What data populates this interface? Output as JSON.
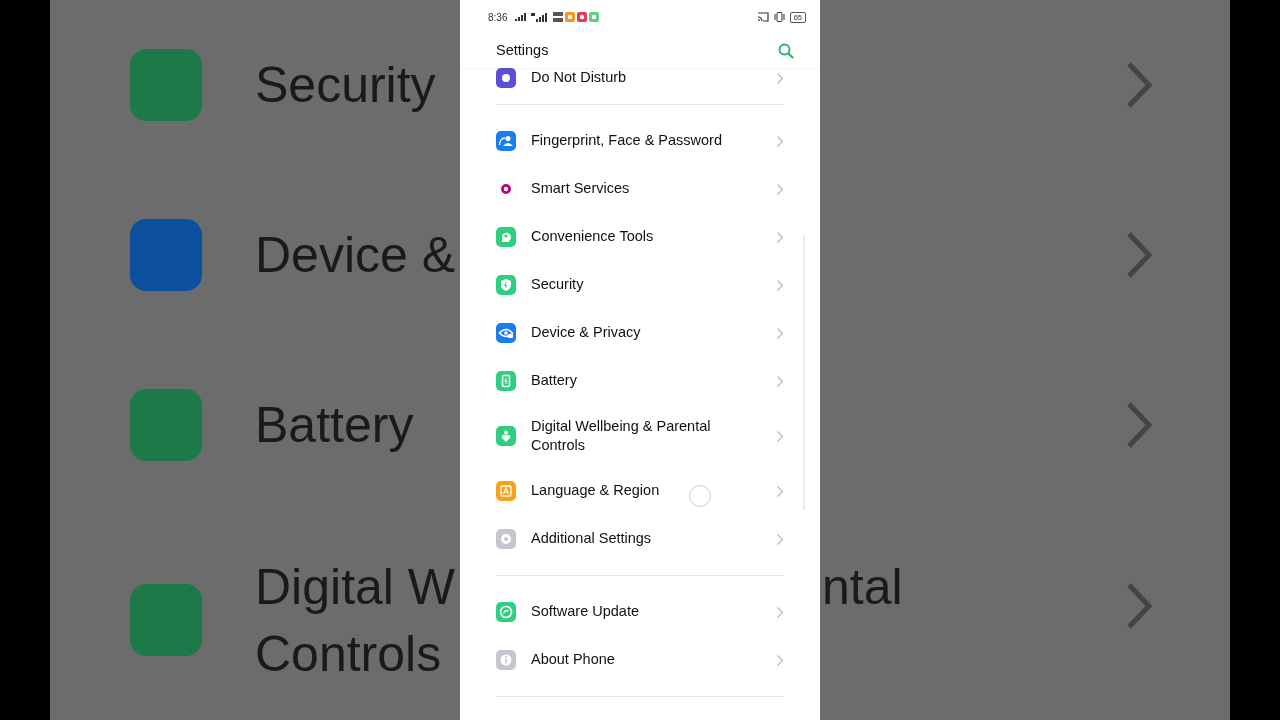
{
  "backdrop": {
    "rows": [
      {
        "lines": [
          "Security"
        ],
        "color": "#1d7a48"
      },
      {
        "lines": [
          "Device &"
        ],
        "color": "#0c4f9e"
      },
      {
        "lines": [
          "Battery"
        ],
        "color": "#1d7a48"
      },
      {
        "lines": [
          "Digital W",
          "Controls"
        ],
        "right_text": "ntal",
        "color": "#1d7a48"
      }
    ]
  },
  "status_bar": {
    "time": "8:36",
    "battery": "65"
  },
  "header": {
    "title": "Settings"
  },
  "groups": [
    [
      {
        "label": "Do Not Disturb",
        "color": "#5b4fd6"
      }
    ],
    [
      {
        "label": "Fingerprint, Face & Password",
        "color": "#1a7cf0"
      },
      {
        "label": "Smart Services",
        "color": "#ffffff"
      },
      {
        "label": "Convenience Tools",
        "color": "#2ecf80"
      },
      {
        "label": "Security",
        "color": "#2ecf80"
      },
      {
        "label": "Device & Privacy",
        "color": "#1a7cf0"
      },
      {
        "label": "Battery",
        "color": "#2ecf80"
      },
      {
        "label": "Digital Wellbeing & Parental Controls",
        "color": "#2ecf80"
      },
      {
        "label": "Language & Region",
        "color": "#f7a21b"
      },
      {
        "label": "Additional Settings",
        "color": "#c5c6cf"
      }
    ],
    [
      {
        "label": "Software Update",
        "color": "#2ecf80"
      },
      {
        "label": "About Phone",
        "color": "#c5c6cf"
      }
    ]
  ]
}
